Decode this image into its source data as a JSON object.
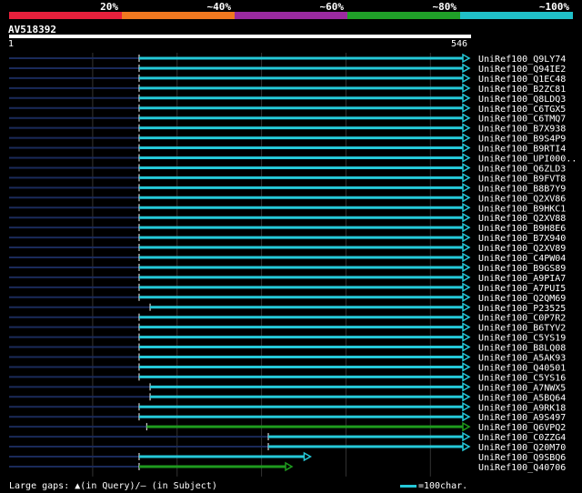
{
  "scale": {
    "segments": [
      {
        "color": "#e8203c"
      },
      {
        "color": "#f07820"
      },
      {
        "color": "#9a2aa0"
      },
      {
        "color": "#20a028"
      },
      {
        "color": "#20c0c8"
      }
    ],
    "labels": [
      "20%",
      "~40%",
      "~60%",
      "~80%",
      "~100%"
    ]
  },
  "query": {
    "name": "AV518392",
    "start_label": "1",
    "end_label": "546",
    "length": 546
  },
  "colors": {
    "cyan": "#25c8d8",
    "green": "#1e9a1e",
    "dark_line": "#1a2a5a",
    "grid": "#333333"
  },
  "hits": [
    {
      "name": "UniRef100_Q9LY74",
      "start": 155,
      "end": 546,
      "color": "cyan"
    },
    {
      "name": "UniRef100_Q94IE2",
      "start": 155,
      "end": 546,
      "color": "cyan"
    },
    {
      "name": "UniRef100_Q1EC48",
      "start": 155,
      "end": 546,
      "color": "cyan"
    },
    {
      "name": "UniRef100_B2ZC81",
      "start": 155,
      "end": 546,
      "color": "cyan"
    },
    {
      "name": "UniRef100_Q8LDQ3",
      "start": 155,
      "end": 546,
      "color": "cyan"
    },
    {
      "name": "UniRef100_C6TGX5",
      "start": 155,
      "end": 546,
      "color": "cyan"
    },
    {
      "name": "UniRef100_C6TMQ7",
      "start": 155,
      "end": 546,
      "color": "cyan"
    },
    {
      "name": "UniRef100_B7X938",
      "start": 155,
      "end": 546,
      "color": "cyan"
    },
    {
      "name": "UniRef100_B9S4P9",
      "start": 155,
      "end": 546,
      "color": "cyan"
    },
    {
      "name": "UniRef100_B9RTI4",
      "start": 155,
      "end": 546,
      "color": "cyan"
    },
    {
      "name": "UniRef100_UPI000..",
      "start": 155,
      "end": 546,
      "color": "cyan"
    },
    {
      "name": "UniRef100_Q6ZLD3",
      "start": 155,
      "end": 546,
      "color": "cyan"
    },
    {
      "name": "UniRef100_B9FVT8",
      "start": 155,
      "end": 546,
      "color": "cyan"
    },
    {
      "name": "UniRef100_B8B7Y9",
      "start": 155,
      "end": 546,
      "color": "cyan"
    },
    {
      "name": "UniRef100_Q2XV86",
      "start": 155,
      "end": 546,
      "color": "cyan"
    },
    {
      "name": "UniRef100_B9HKC1",
      "start": 155,
      "end": 546,
      "color": "cyan"
    },
    {
      "name": "UniRef100_Q2XV88",
      "start": 155,
      "end": 546,
      "color": "cyan"
    },
    {
      "name": "UniRef100_B9H8E6",
      "start": 155,
      "end": 546,
      "color": "cyan"
    },
    {
      "name": "UniRef100_B7X940",
      "start": 155,
      "end": 546,
      "color": "cyan"
    },
    {
      "name": "UniRef100_Q2XV89",
      "start": 155,
      "end": 546,
      "color": "cyan"
    },
    {
      "name": "UniRef100_C4PW04",
      "start": 155,
      "end": 546,
      "color": "cyan"
    },
    {
      "name": "UniRef100_B9GS89",
      "start": 155,
      "end": 546,
      "color": "cyan"
    },
    {
      "name": "UniRef100_A9PIA7",
      "start": 155,
      "end": 546,
      "color": "cyan"
    },
    {
      "name": "UniRef100_A7PUI5",
      "start": 155,
      "end": 546,
      "color": "cyan"
    },
    {
      "name": "UniRef100_Q2QM69",
      "start": 155,
      "end": 546,
      "color": "cyan"
    },
    {
      "name": "UniRef100_P23525",
      "start": 168,
      "end": 546,
      "color": "cyan"
    },
    {
      "name": "UniRef100_C0P7R2",
      "start": 155,
      "end": 546,
      "color": "cyan"
    },
    {
      "name": "UniRef100_B6TYV2",
      "start": 155,
      "end": 546,
      "color": "cyan"
    },
    {
      "name": "UniRef100_C5YS19",
      "start": 155,
      "end": 546,
      "color": "cyan"
    },
    {
      "name": "UniRef100_B8LQ08",
      "start": 155,
      "end": 546,
      "color": "cyan"
    },
    {
      "name": "UniRef100_A5AK93",
      "start": 155,
      "end": 546,
      "color": "cyan"
    },
    {
      "name": "UniRef100_Q40501",
      "start": 155,
      "end": 546,
      "color": "cyan"
    },
    {
      "name": "UniRef100_C5YS16",
      "start": 155,
      "end": 546,
      "color": "cyan"
    },
    {
      "name": "UniRef100_A7NWX5",
      "start": 168,
      "end": 546,
      "color": "cyan"
    },
    {
      "name": "UniRef100_A5BQ64",
      "start": 168,
      "end": 546,
      "color": "cyan"
    },
    {
      "name": "UniRef100_A9RK18",
      "start": 155,
      "end": 546,
      "color": "cyan"
    },
    {
      "name": "UniRef100_A9S497",
      "start": 155,
      "end": 546,
      "color": "cyan"
    },
    {
      "name": "UniRef100_Q6VPQ2",
      "start": 164,
      "end": 546,
      "color": "green"
    },
    {
      "name": "UniRef100_C0ZZG4",
      "start": 308,
      "end": 546,
      "color": "cyan"
    },
    {
      "name": "UniRef100_Q20M70",
      "start": 308,
      "end": 546,
      "color": "cyan"
    },
    {
      "name": "UniRef100_Q9SBQ6",
      "start": 155,
      "end": 358,
      "color": "cyan"
    },
    {
      "name": "UniRef100_Q40706",
      "start": 155,
      "end": 336,
      "color": "green"
    }
  ],
  "legend": {
    "large_gaps": "Large gaps:",
    "in_query": "(in Query)/",
    "in_subject": "(in Subject)",
    "scale_text": "=100char."
  }
}
